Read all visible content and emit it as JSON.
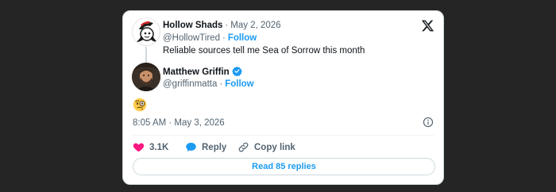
{
  "quoted": {
    "name": "Hollow Shads",
    "date": "May 2, 2026",
    "handle": "@HollowTired",
    "follow": "Follow",
    "text": "Reliable sources tell me Sea of Sorrow this month"
  },
  "author": {
    "name": "Matthew Griffin",
    "handle": "@griffinmatta",
    "follow": "Follow",
    "verified": true
  },
  "post": {
    "emoji": "thinking-monocle-emoji",
    "timestamp": "8:05 AM · May 3, 2026"
  },
  "actions": {
    "likes": "3.1K",
    "reply_label": "Reply",
    "copy_label": "Copy link"
  },
  "read_replies": "Read 85 replies",
  "colors": {
    "accent": "#1d9bf0",
    "like": "#f91880",
    "background": "#252525",
    "card": "#ffffff"
  }
}
